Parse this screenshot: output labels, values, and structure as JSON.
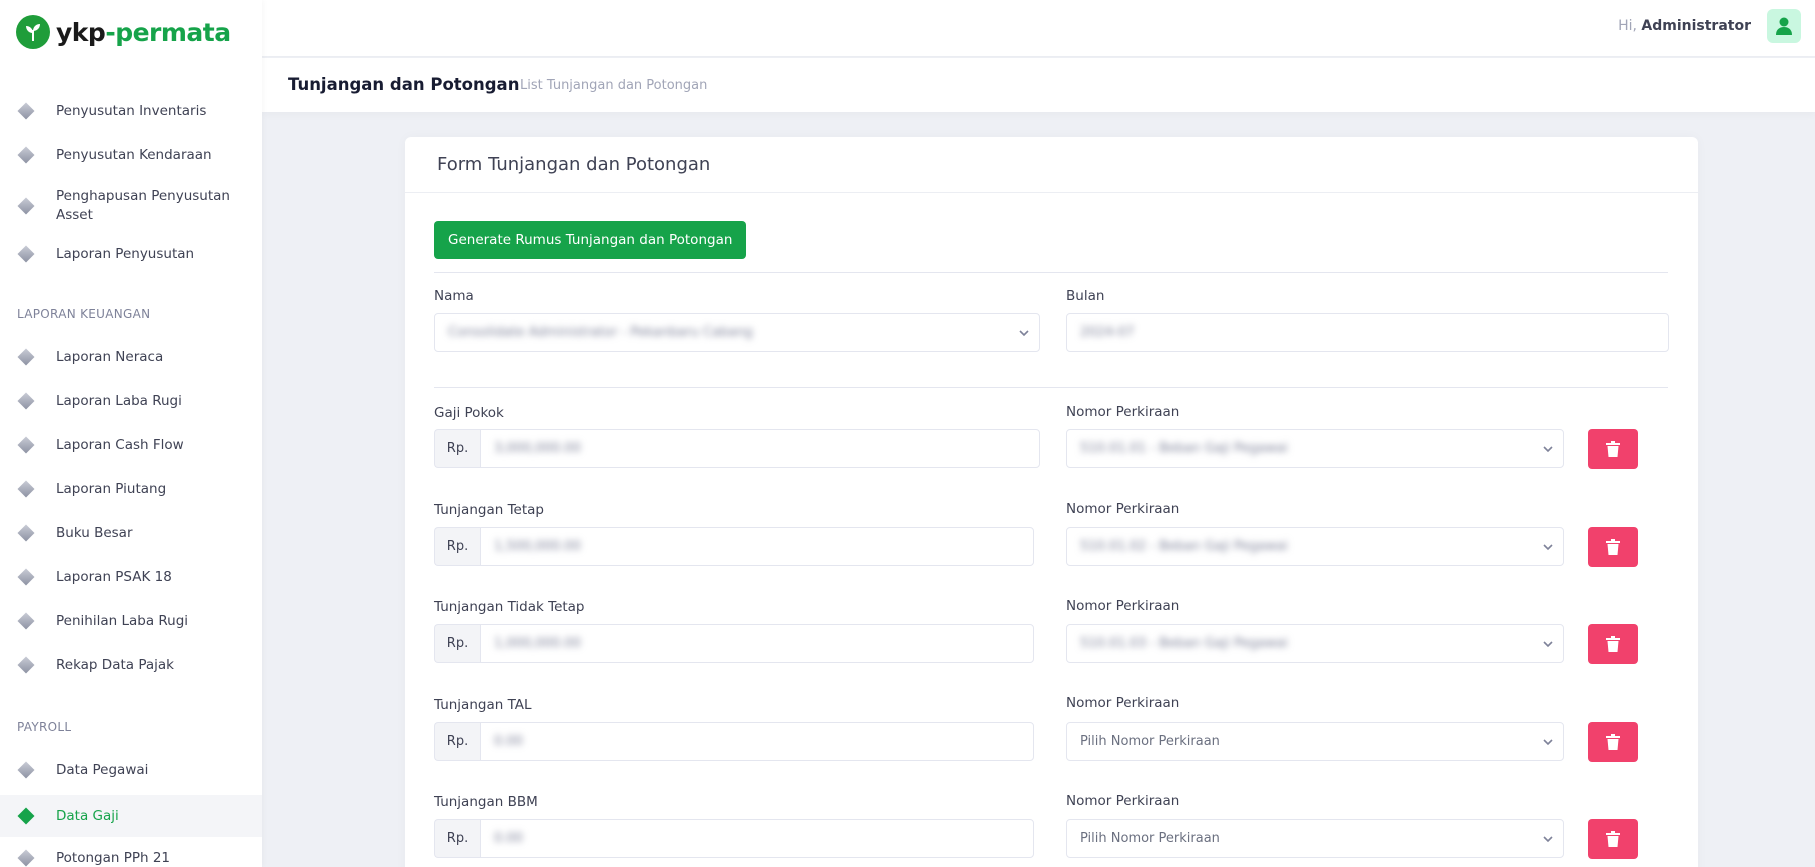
{
  "brand": {
    "name_main": "ykp",
    "name_accent": "-permata"
  },
  "header": {
    "greeting": "Hi,",
    "user": "Administrator"
  },
  "subheader": {
    "title": "Tunjangan dan Potongan",
    "breadcrumb": "List Tunjangan dan Potongan"
  },
  "sidebar": {
    "items": [
      {
        "label": "Penyusutan Inventaris"
      },
      {
        "label": "Penyusutan Kendaraan"
      },
      {
        "label": "Penghapusan Penyusutan Asset"
      },
      {
        "label": "Laporan Penyusutan"
      }
    ],
    "section_keuangan": "LAPORAN KEUANGAN",
    "keuangan_items": [
      {
        "label": "Laporan Neraca"
      },
      {
        "label": "Laporan Laba Rugi"
      },
      {
        "label": "Laporan Cash Flow"
      },
      {
        "label": "Laporan Piutang"
      },
      {
        "label": "Buku Besar"
      },
      {
        "label": "Laporan PSAK 18"
      },
      {
        "label": "Penihilan Laba Rugi"
      },
      {
        "label": "Rekap Data Pajak"
      }
    ],
    "section_payroll": "PAYROLL",
    "payroll_items": [
      {
        "label": "Data Pegawai"
      },
      {
        "label": "Data Gaji",
        "active": true
      },
      {
        "label": "Potongan PPh 21"
      }
    ]
  },
  "form": {
    "title": "Form Tunjangan dan Potongan",
    "generate_button": "Generate Rumus Tunjangan dan Potongan",
    "nama_label": "Nama",
    "nama_value": "Consolidate Administrator - Pekanbaru Cabang",
    "bulan_label": "Bulan",
    "bulan_value": "2024-07",
    "prefix": "Rp.",
    "nomor_label": "Nomor Perkiraan",
    "nomor_placeholder": "Pilih Nomor Perkiraan",
    "rows": [
      {
        "label": "Gaji Pokok",
        "amount": "3,000,000.00",
        "nomor": "510.01.01 - Beban Gaji Pegawai"
      },
      {
        "label": "Tunjangan Tetap",
        "amount": "1,500,000.00",
        "nomor": "510.01.02 - Beban Gaji Pegawai"
      },
      {
        "label": "Tunjangan Tidak Tetap",
        "amount": "1,000,000.00",
        "nomor": "510.01.03 - Beban Gaji Pegawai"
      },
      {
        "label": "Tunjangan TAL",
        "amount": "0.00",
        "nomor": ""
      },
      {
        "label": "Tunjangan BBM",
        "amount": "0.00",
        "nomor": ""
      }
    ]
  },
  "colors": {
    "primary": "#16a34a",
    "danger": "#f1416c"
  }
}
